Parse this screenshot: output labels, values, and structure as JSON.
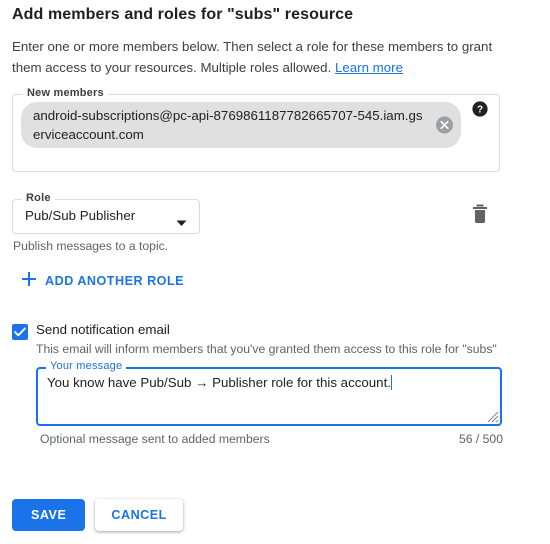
{
  "dialog": {
    "title": "Add members and roles for \"subs\" resource",
    "description_part1": "Enter one or more members below. Then select a role for these members to grant them access to your resources. Multiple roles allowed. ",
    "learn_more_label": "Learn more"
  },
  "members_field": {
    "legend": "New members",
    "chip_value": "android-subscriptions@pc-api-8769861187782665707-545.iam.gserviceaccount.com",
    "remove_icon": "close-circle-icon",
    "help_icon": "help-circle-icon"
  },
  "role_field": {
    "legend": "Role",
    "selected_value": "Pub/Sub Publisher",
    "hint": "Publish messages to a topic.",
    "dropdown_icon": "chevron-down-icon",
    "delete_icon": "trash-icon"
  },
  "add_role": {
    "label": "ADD ANOTHER ROLE",
    "icon": "plus-icon"
  },
  "notification": {
    "checkbox_checked": true,
    "label": "Send notification email",
    "sub_label": "This email will inform members that you've granted them access to this role for \"subs\"",
    "message_legend": "Your message",
    "message_value": "You know have Pub/Sub → Publisher role for this account.",
    "message_help": "Optional message sent to added members",
    "char_count": "56 / 500"
  },
  "actions": {
    "save_label": "SAVE",
    "cancel_label": "CANCEL"
  },
  "colors": {
    "accent": "#1a73e8",
    "border": "#dadce0",
    "chip_bg": "#e0e0e0",
    "muted_text": "#5f6368"
  }
}
